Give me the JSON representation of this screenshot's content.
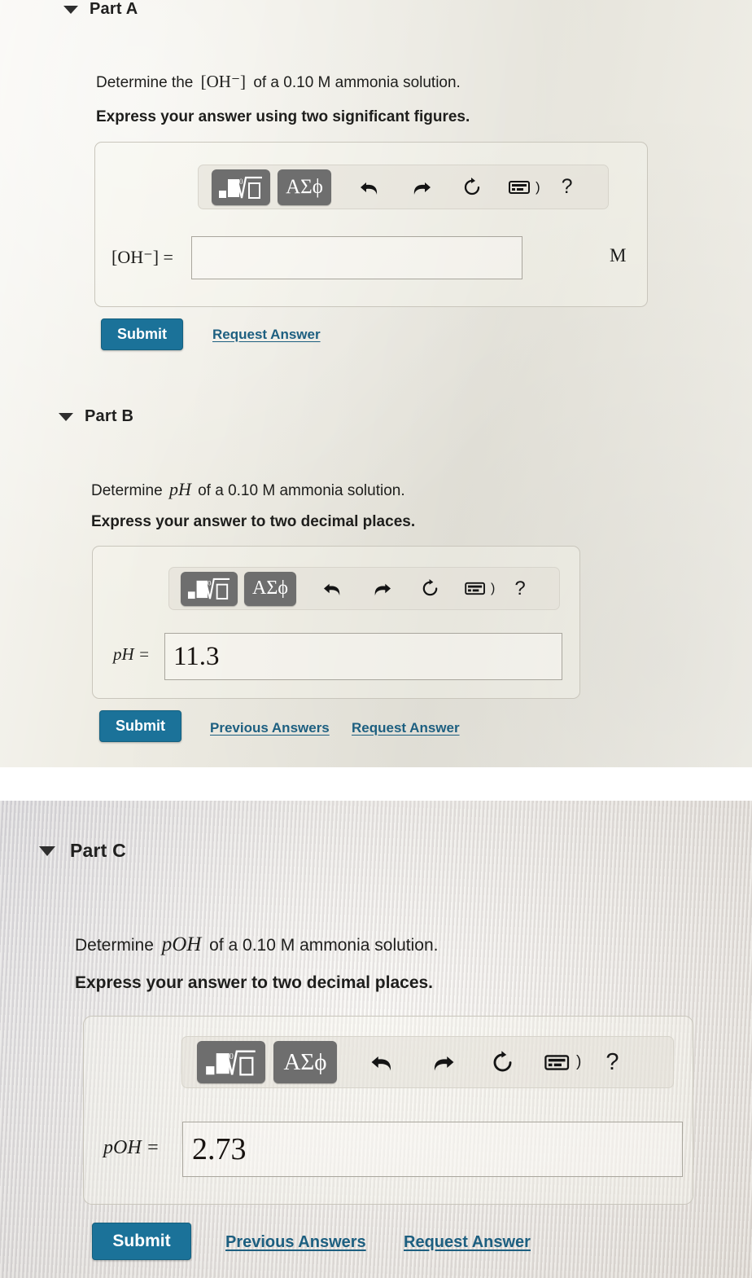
{
  "document": {
    "type": "chemistry-homework",
    "theme": {
      "submit_color": "#1b7299",
      "link_color": "#1d5f80",
      "text_color": "#1e1e1c",
      "card_border": "#c9c6bc",
      "toolbar_button": "#6e6e6e",
      "page_background": "#eeece3"
    }
  },
  "toolbar": {
    "buttons": [
      {
        "name": "math-template-button",
        "label": "■√□"
      },
      {
        "name": "greek-letters-button",
        "label": "ΑΣϕ"
      }
    ],
    "icons": [
      {
        "name": "undo-icon",
        "label": "undo"
      },
      {
        "name": "redo-icon",
        "label": "redo"
      },
      {
        "name": "reset-icon",
        "label": "reset"
      },
      {
        "name": "keyboard-icon",
        "label": "keyboard shortcuts"
      },
      {
        "name": "help-icon",
        "label": "?"
      }
    ],
    "help_glyph": "?",
    "keyboard_bracket": ")"
  },
  "parts": [
    {
      "id": "part-a",
      "title": "Part A",
      "question_prefix": "Determine the",
      "question_symbol": "[OH⁻]",
      "question_suffix": "of a 0.10 M ammonia solution.",
      "question_full": "Determine the [OH⁻] of a 0.10 M ammonia solution.",
      "instruction": "Express your answer using two significant figures.",
      "field_label": "[OH⁻] =",
      "field_value": "",
      "unit": "M",
      "submit_label": "Submit",
      "links": [
        "Request Answer"
      ]
    },
    {
      "id": "part-b",
      "title": "Part B",
      "question_prefix": "Determine",
      "question_symbol": "pH",
      "question_suffix": "of a 0.10 M ammonia solution.",
      "question_full": "Determine pH of a 0.10 M ammonia solution.",
      "instruction": "Express your answer to two decimal places.",
      "field_label": "pH =",
      "field_value": "11.3",
      "unit": "",
      "submit_label": "Submit",
      "links": [
        "Previous Answers",
        "Request Answer"
      ]
    },
    {
      "id": "part-c",
      "title": "Part C",
      "question_prefix": "Determine",
      "question_symbol": "pOH",
      "question_suffix": "of a 0.10 M ammonia solution.",
      "question_full": "Determine pOH of a 0.10 M ammonia solution.",
      "instruction": "Express your answer to two decimal places.",
      "field_label": "pOH =",
      "field_value": "2.73",
      "unit": "",
      "submit_label": "Submit",
      "links": [
        "Previous Answers",
        "Request Answer"
      ]
    }
  ]
}
